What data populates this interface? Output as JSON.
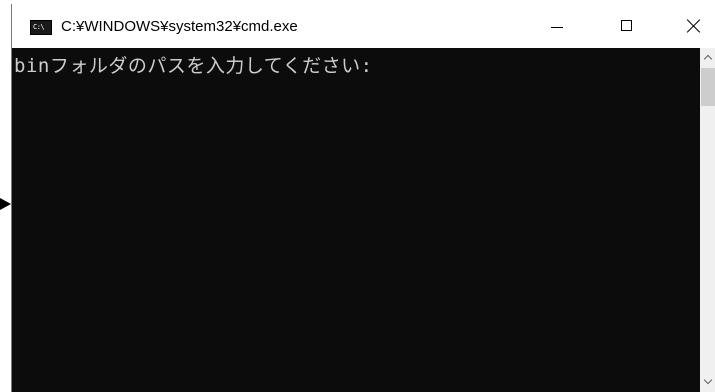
{
  "window": {
    "title": "C:¥WINDOWS¥system32¥cmd.exe",
    "app_icon_text": "C:\\",
    "app_icon": "cmd-console-icon"
  },
  "controls": {
    "minimize_icon": "minimize-icon",
    "maximize_icon": "maximize-icon",
    "close_icon": "close-icon"
  },
  "console": {
    "lines": [
      "binフォルダのパスを入力してください:"
    ],
    "background_color": "#0c0c0c",
    "text_color": "#cccccc"
  },
  "annotation": {
    "pointer_icon": "right-pointing-arrow-icon"
  }
}
